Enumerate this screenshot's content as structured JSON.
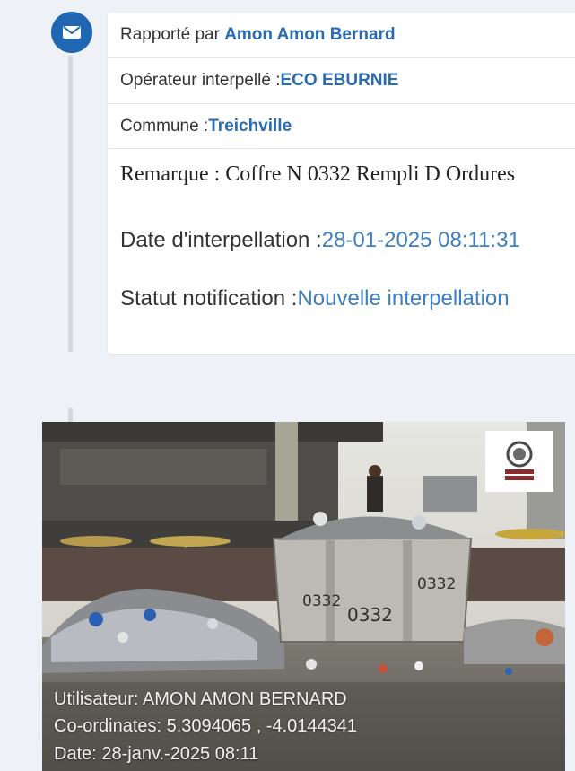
{
  "report": {
    "reported_by_label": "Rapporté par ",
    "reported_by_value": "Amon Amon Bernard",
    "operator_label": "Opérateur interpellé :",
    "operator_value": "ECO EBURNIE",
    "commune_label": "Commune :",
    "commune_value": "Treichville",
    "remark_text": "Remarque : Coffre N 0332 Rempli D Ordures",
    "date_label": "Date d'interpellation :",
    "date_value": "28-01-2025 08:11:31",
    "status_label": "Statut notification :",
    "status_value": "Nouvelle interpellation"
  },
  "photo": {
    "overlay_user": "Utilisateur: AMON AMON BERNARD",
    "overlay_coords": "Co-ordinates: 5.3094065 , -4.0144341",
    "overlay_date": "Date: 28-janv.-2025 08:11",
    "container_marks": [
      "0332",
      "0332",
      "0332"
    ],
    "logo_text": "BUREAU VERITAS"
  },
  "icons": {
    "badge": "envelope-icon"
  },
  "colors": {
    "accent": "#1f66b3",
    "link": "#2a6bb2",
    "value": "#3d7fc1"
  }
}
